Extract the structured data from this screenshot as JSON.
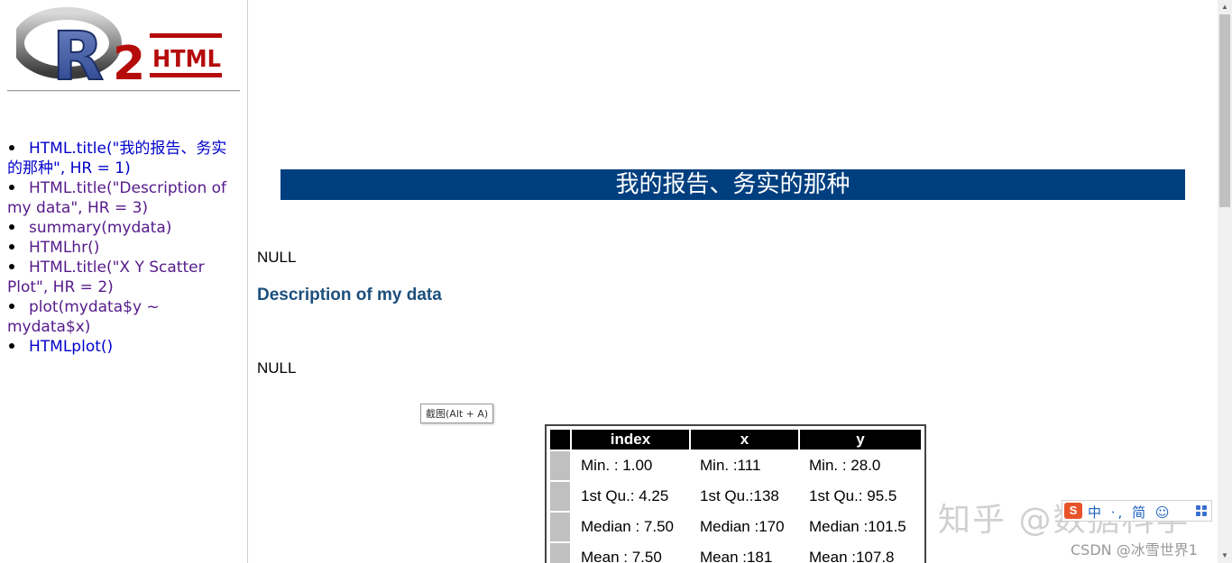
{
  "logo": {
    "letter": "R",
    "number": "2",
    "text": "HTML"
  },
  "nav": {
    "items": [
      {
        "label": "HTML.title(\"我的报告、务实的那种\", HR = 1)",
        "state": "fresh"
      },
      {
        "label": "HTML.title(\"Description of my data\", HR = 3)",
        "state": "visited"
      },
      {
        "label": "summary(mydata)",
        "state": "visited"
      },
      {
        "label": "HTMLhr()",
        "state": "visited"
      },
      {
        "label": "HTML.title(\"X Y Scatter Plot\", HR = 2)",
        "state": "visited"
      },
      {
        "label": "plot(mydata$y ~ mydata$x)",
        "state": "visited"
      },
      {
        "label": "HTMLplot()",
        "state": "fresh"
      }
    ]
  },
  "main": {
    "title": "我的报告、务实的那种",
    "null_1": "NULL",
    "heading": "Description of my data",
    "null_2": "NULL"
  },
  "tooltip": "截图(Alt + A)",
  "summary_table": {
    "headers": [
      "index",
      "x",
      "y"
    ],
    "rows": [
      [
        "Min. : 1.00",
        "Min. :111",
        "Min. : 28.0"
      ],
      [
        "1st Qu.: 4.25",
        "1st Qu.:138",
        "1st Qu.: 95.5"
      ],
      [
        "Median : 7.50",
        "Median :170",
        "Median :101.5"
      ],
      [
        "Mean : 7.50",
        "Mean :181",
        "Mean :107.8"
      ]
    ]
  },
  "overlays": {
    "ime_logo": "S",
    "ime_text": "中 ·, 简 ☺",
    "watermark_zhihu": "知乎 @数据科学",
    "watermark_csdn": "CSDN @冰雪世界1"
  },
  "colors": {
    "title_banner": "#003f7f",
    "heading": "#1c4f7c",
    "visited_link": "#551a8b",
    "link": "#0000cc"
  }
}
